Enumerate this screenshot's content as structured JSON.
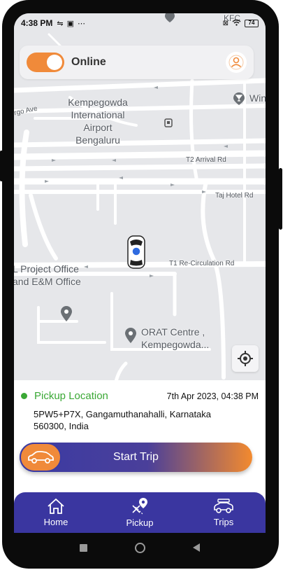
{
  "status_bar": {
    "time": "4:38 PM",
    "battery": "74",
    "icons": [
      "usb-icon",
      "card-icon",
      "more-icon",
      "sim-off-icon",
      "wifi-icon",
      "battery-icon"
    ]
  },
  "header": {
    "status_label": "Online",
    "toggle_on": true
  },
  "map": {
    "labels": {
      "airport_line1": "Kempegowda",
      "airport_line2": "International",
      "airport_line3": "Airport",
      "airport_line4": "Bengaluru",
      "project_office_line1": "L Project Office",
      "project_office_line2": "and E&M Office",
      "orat_line1": "ORAT Centre ,",
      "orat_line2": "Kempegowda...",
      "wine": "Wine",
      "kfc": "KFC"
    },
    "roads": {
      "cargo_ave": "rgo Ave",
      "t2_arrival": "T2 Arrival Rd",
      "taj_hotel": "Taj Hotel Rd",
      "t1_recirculation": "T1 Re-Circulation Rd"
    }
  },
  "pickup": {
    "title": "Pickup Location",
    "datetime": "7th Apr 2023, 04:38 PM",
    "address_line1": "5PW5+P7X, Gangamuthanahalli, Karnataka",
    "address_line2": "560300, India"
  },
  "actions": {
    "start_trip": "Start Trip"
  },
  "bottom_nav": {
    "items": [
      {
        "label": "Home",
        "icon": "home-icon"
      },
      {
        "label": "Pickup",
        "icon": "pickup-icon"
      },
      {
        "label": "Trips",
        "icon": "car-icon"
      }
    ]
  },
  "colors": {
    "accent_orange": "#f08a3a",
    "nav_purple": "#3a36a0",
    "pickup_green": "#3aa835"
  }
}
